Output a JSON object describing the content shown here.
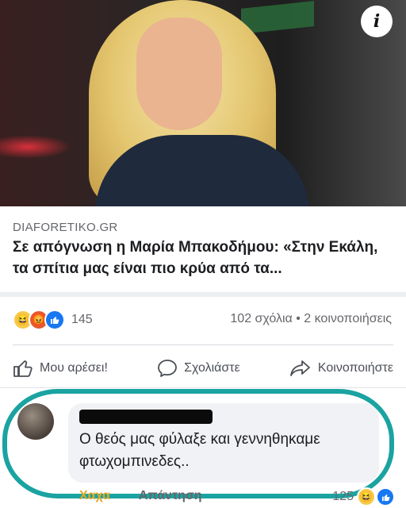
{
  "post": {
    "source": "DIAFORETIKO.GR",
    "headline": "Σε απόγνωση η Μαρία Μπακοδήμου: «Στην Εκάλη, τα σπίτια μας είναι πιο κρύα από τα...",
    "reaction_count": "145",
    "stats": "102 σχόλια • 2 κοινοποιήσεις",
    "reaction_icons": [
      "haha-emoji",
      "angry-emoji",
      "like-emoji"
    ]
  },
  "actions": {
    "like": "Μου αρέσει!",
    "comment": "Σχολιάστε",
    "share": "Κοινοποιήστε"
  },
  "comment": {
    "text": "Ο θεός μας φύλαξε και γεννηθηκαμε φτωχομπινεδες..",
    "haha_label": "Χαχα",
    "reply_label": "Απάντηση",
    "reaction_count": "125"
  },
  "colors": {
    "highlight": "#1aa3a1",
    "like_blue": "#1877f2",
    "text_secondary": "#65676b"
  }
}
